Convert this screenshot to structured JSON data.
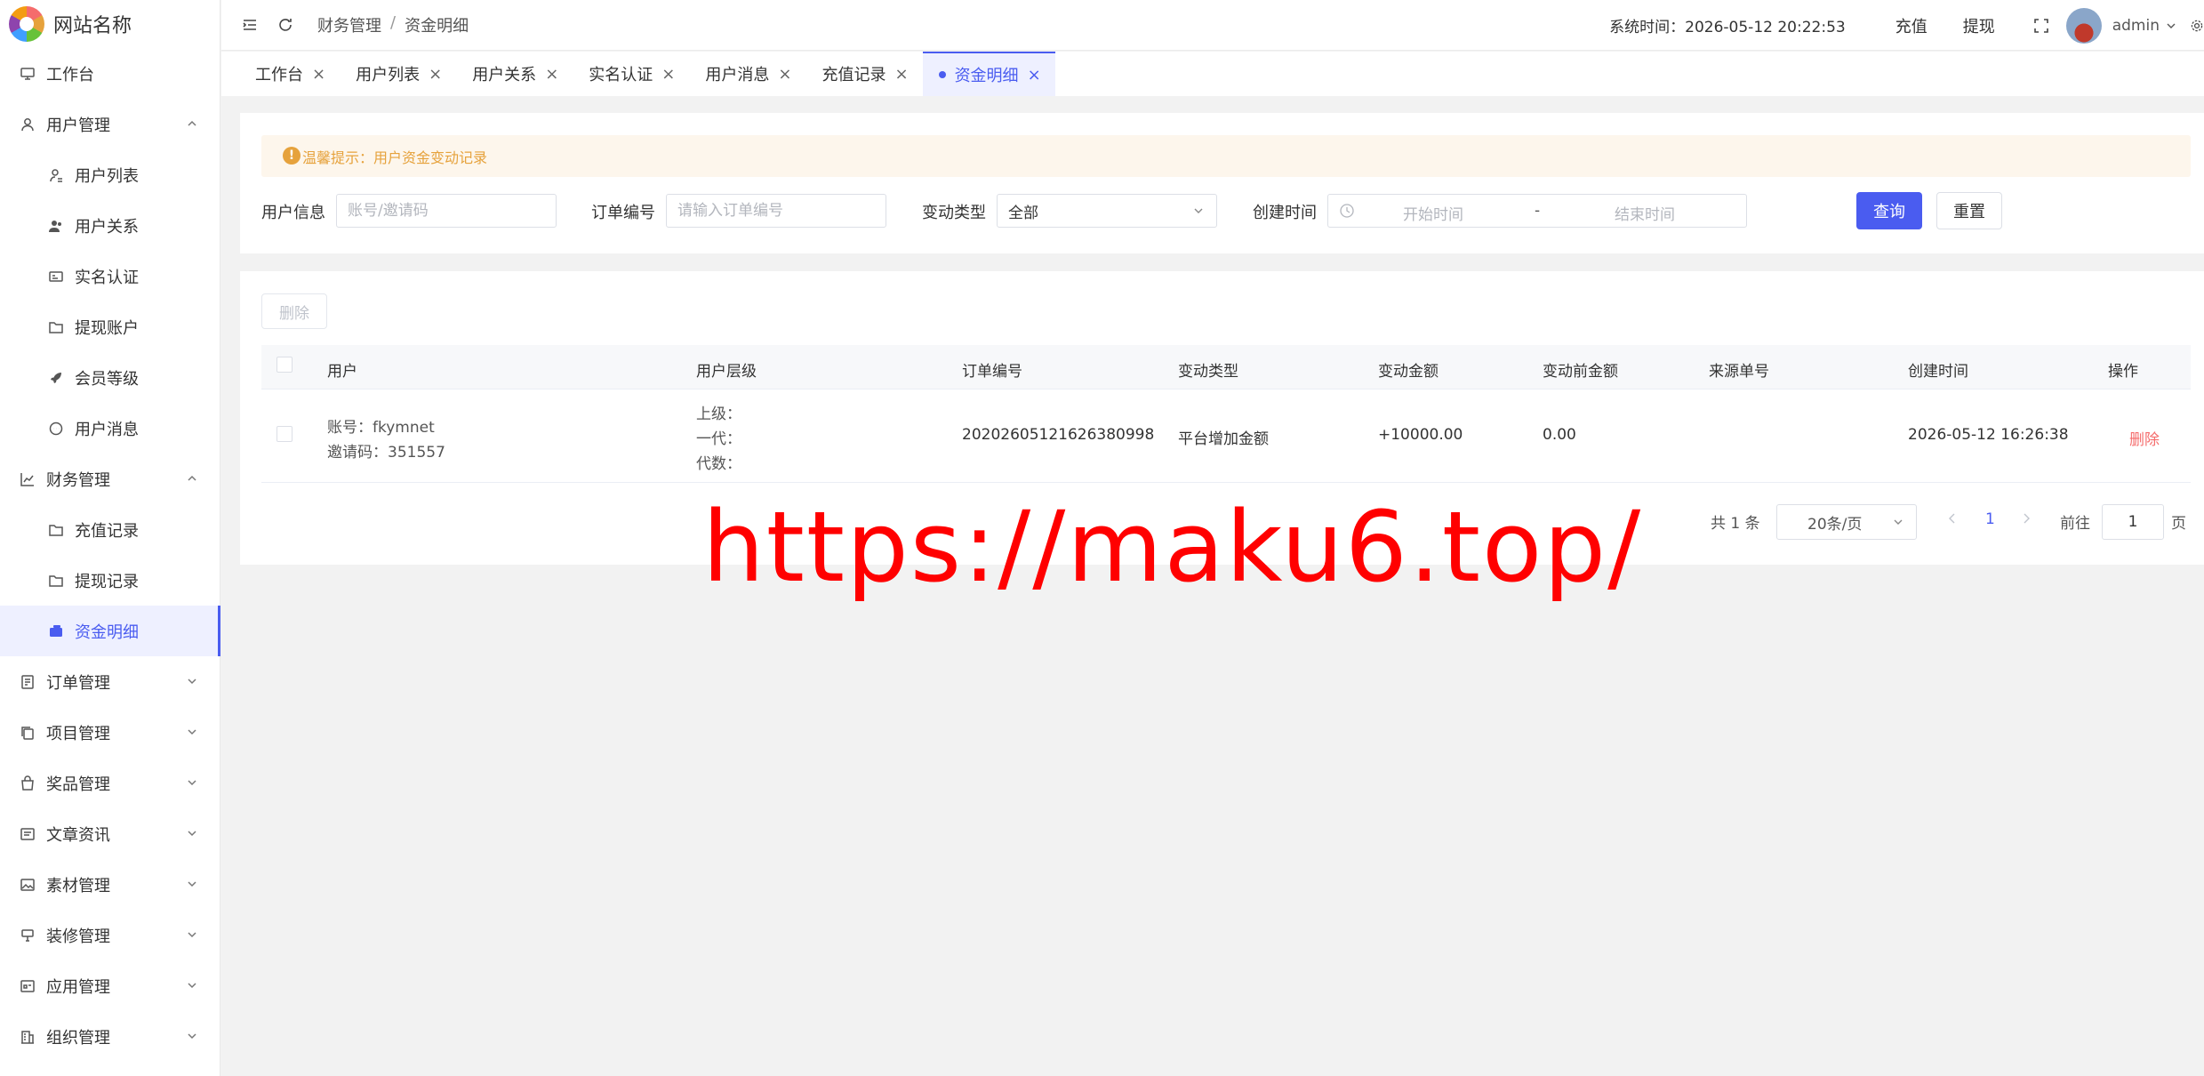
{
  "sidebar": {
    "site_name": "网站名称",
    "items": [
      {
        "label": "工作台",
        "icon": "monitor-icon"
      },
      {
        "label": "用户管理",
        "icon": "user-icon"
      },
      {
        "label": "用户列表",
        "icon": "user-list-icon"
      },
      {
        "label": "用户关系",
        "icon": "users-icon"
      },
      {
        "label": "实名认证",
        "icon": "id-card-icon"
      },
      {
        "label": "提现账户",
        "icon": "folder-icon"
      },
      {
        "label": "会员等级",
        "icon": "rocket-icon"
      },
      {
        "label": "用户消息",
        "icon": "chat-icon"
      },
      {
        "label": "财务管理",
        "icon": "chart-icon"
      },
      {
        "label": "充值记录",
        "icon": "folder-icon"
      },
      {
        "label": "提现记录",
        "icon": "folder-icon"
      },
      {
        "label": "资金明细",
        "icon": "wallet-icon"
      },
      {
        "label": "订单管理",
        "icon": "order-icon"
      },
      {
        "label": "项目管理",
        "icon": "copy-icon"
      },
      {
        "label": "奖品管理",
        "icon": "bag-icon"
      },
      {
        "label": "文章资讯",
        "icon": "article-icon"
      },
      {
        "label": "素材管理",
        "icon": "image-icon"
      },
      {
        "label": "装修管理",
        "icon": "brush-icon"
      },
      {
        "label": "应用管理",
        "icon": "app-icon"
      },
      {
        "label": "组织管理",
        "icon": "building-icon"
      }
    ]
  },
  "header": {
    "breadcrumb": [
      "财务管理",
      "资金明细"
    ],
    "breadcrumb_sep": "/",
    "system_time": "系统时间：2026-05-12 20:22:53",
    "recharge": "充值",
    "withdraw": "提现",
    "user": "admin"
  },
  "tabs": [
    {
      "label": "工作台"
    },
    {
      "label": "用户列表"
    },
    {
      "label": "用户关系"
    },
    {
      "label": "实名认证"
    },
    {
      "label": "用户消息"
    },
    {
      "label": "充值记录"
    },
    {
      "label": "资金明细",
      "active": true
    }
  ],
  "filter": {
    "tip": "温馨提示：用户资金变动记录",
    "user_info_label": "用户信息",
    "user_info_placeholder": "账号/邀请码",
    "order_no_label": "订单编号",
    "order_no_placeholder": "请输入订单编号",
    "change_type_label": "变动类型",
    "change_type_value": "全部",
    "created_label": "创建时间",
    "start_placeholder": "开始时间",
    "range_sep": "-",
    "end_placeholder": "结束时间",
    "query": "查询",
    "reset": "重置"
  },
  "table": {
    "delete_button": "删除",
    "columns": [
      "用户",
      "用户层级",
      "订单编号",
      "变动类型",
      "变动金额",
      "变动前金额",
      "来源单号",
      "创建时间",
      "操作"
    ],
    "rows": [
      {
        "account": "账号：fkymnet",
        "invite": "邀请码：351557",
        "level_parent": "上级：",
        "level_gen": "一代：",
        "level_depth": "代数：",
        "order_no": "20202605121626380998",
        "change_type": "平台增加金额",
        "amount": "+10000.00",
        "before": "0.00",
        "source": "",
        "created": "2026-05-12 16:26:38",
        "action": "删除"
      }
    ]
  },
  "pagination": {
    "total": "共 1 条",
    "page_size": "20条/页",
    "current": "1",
    "goto_label": "前往",
    "goto_value": "1",
    "page_suffix": "页"
  },
  "watermark": "https://maku6.top/",
  "colors": {
    "primary": "#4a5cf0",
    "danger": "#f56c6c",
    "warning": "#e6a23c"
  }
}
